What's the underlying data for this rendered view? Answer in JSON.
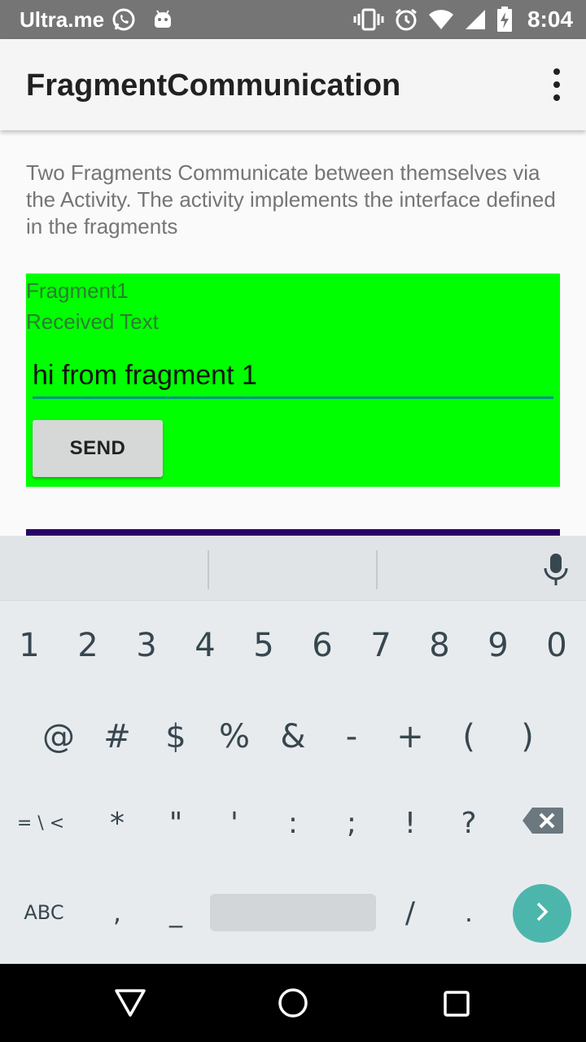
{
  "status_bar": {
    "carrier": "Ultra.me",
    "time": "8:04",
    "icons": [
      "whatsapp-icon",
      "android-icon",
      "vibrate-icon",
      "alarm-icon",
      "wifi-icon",
      "signal-icon",
      "battery-charging-icon"
    ]
  },
  "app_bar": {
    "title": "FragmentCommunication",
    "overflow_icon": "more-vert-icon"
  },
  "main": {
    "description": "Two Fragments Communicate between themselves via the Activity. The activity implements the interface defined in the fragments",
    "fragment1": {
      "title": "Fragment1",
      "received_label": "Received Text",
      "input_value": "hi from fragment 1",
      "send_label": "SEND",
      "background": "#00ff00"
    },
    "fragment2": {
      "background": "#2a0066"
    }
  },
  "keyboard": {
    "row1": [
      "1",
      "2",
      "3",
      "4",
      "5",
      "6",
      "7",
      "8",
      "9",
      "0"
    ],
    "row2": [
      "@",
      "#",
      "$",
      "%",
      "&",
      "-",
      "+",
      "(",
      ")"
    ],
    "row3_first": "= \\ <",
    "row3": [
      "*",
      "\"",
      "'",
      ":",
      ";",
      "!",
      "?"
    ],
    "abc_label": "ABC",
    "comma": ",",
    "underscore": "_",
    "slash": "/",
    "period": ".",
    "accent": "#4db6ac"
  },
  "nav_bar": {
    "icons": [
      "back-icon",
      "home-icon",
      "recents-icon"
    ]
  }
}
